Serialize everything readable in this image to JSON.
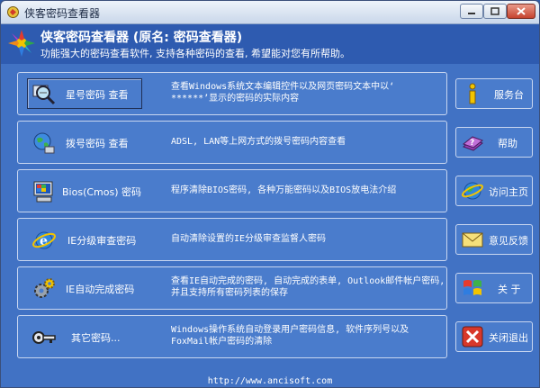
{
  "window": {
    "title": "侠客密码查看器",
    "icon": "app-icon",
    "controls": [
      "minimize-icon",
      "maximize-icon",
      "close-icon"
    ]
  },
  "header": {
    "title": "侠客密码查看器 (原名: 密码查看器)",
    "subtitle": "功能强大的密码查看软件, 支持各种密码的查看, 希望能对您有所帮助。"
  },
  "features": [
    {
      "label": "星号密码 查看",
      "icon": "magnifier-icon",
      "description": "查看Windows系统文本编辑控件以及网页密码文本中以‘ ******’显示的密码的实际内容"
    },
    {
      "label": "拨号密码 查看",
      "icon": "globe-network-icon",
      "description": "ADSL, LAN等上网方式的拨号密码内容查看"
    },
    {
      "label": "Bios(Cmos) 密码",
      "icon": "computer-icon",
      "description": "程序清除BIOS密码, 各种万能密码以及BIOS放电法介绍"
    },
    {
      "label": "IE分级审查密码",
      "icon": "ie-icon",
      "description": "自动清除设置的IE分级审查监督人密码"
    },
    {
      "label": "IE自动完成密码",
      "icon": "gears-icon",
      "description": "查看IE自动完成的密码, 自动完成的表单, Outlook邮件帐户密码, 并且支持所有密码列表的保存"
    },
    {
      "label": "其它密码...",
      "icon": "key-icon",
      "description": "Windows操作系统自动登录用户密码信息, 软件序列号以及FoxMail帐户密码的清除"
    }
  ],
  "sidebar": [
    {
      "label": "服务台",
      "icon": "info-icon"
    },
    {
      "label": "帮助",
      "icon": "help-book-icon"
    },
    {
      "label": "访问主页",
      "icon": "web-globe-icon"
    },
    {
      "label": "意见反馈",
      "icon": "mail-icon"
    },
    {
      "label": "关 于",
      "icon": "windows-logo-icon"
    },
    {
      "label": "关闭退出",
      "icon": "exit-icon"
    }
  ],
  "footer": {
    "url": "http://www.ancisoft.com"
  }
}
